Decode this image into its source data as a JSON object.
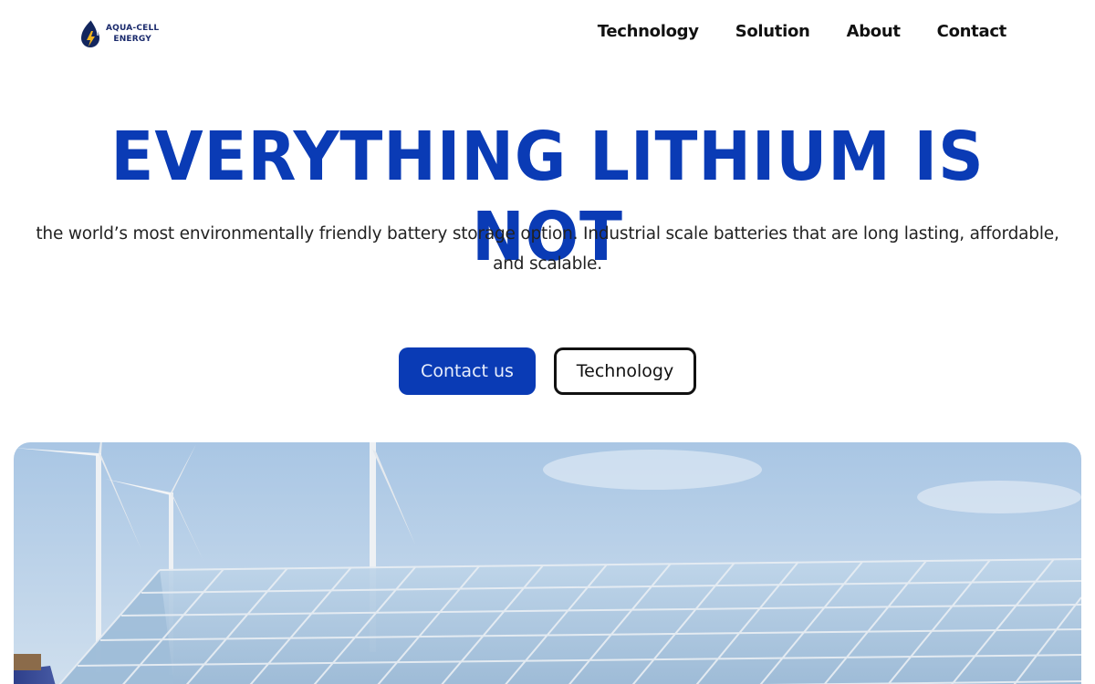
{
  "brand": {
    "name_line1": "AQUA-CELL",
    "name_line2": "ENERGY",
    "logo_icon": "droplet-bolt-icon",
    "accent_color": "#0a3bb5"
  },
  "nav": {
    "items": [
      {
        "label": "Technology"
      },
      {
        "label": "Solution"
      },
      {
        "label": "About"
      },
      {
        "label": "Contact"
      }
    ]
  },
  "hero": {
    "title": "EVERYTHING LITHIUM IS NOT",
    "subtitle": "the world’s most environmentally friendly battery storage option. Industrial scale batteries that are long lasting, affordable, and scalable.",
    "primary_button": "Contact us",
    "secondary_button": "Technology"
  },
  "image": {
    "subject": "solar-greenhouse-wind-turbines-photo"
  }
}
